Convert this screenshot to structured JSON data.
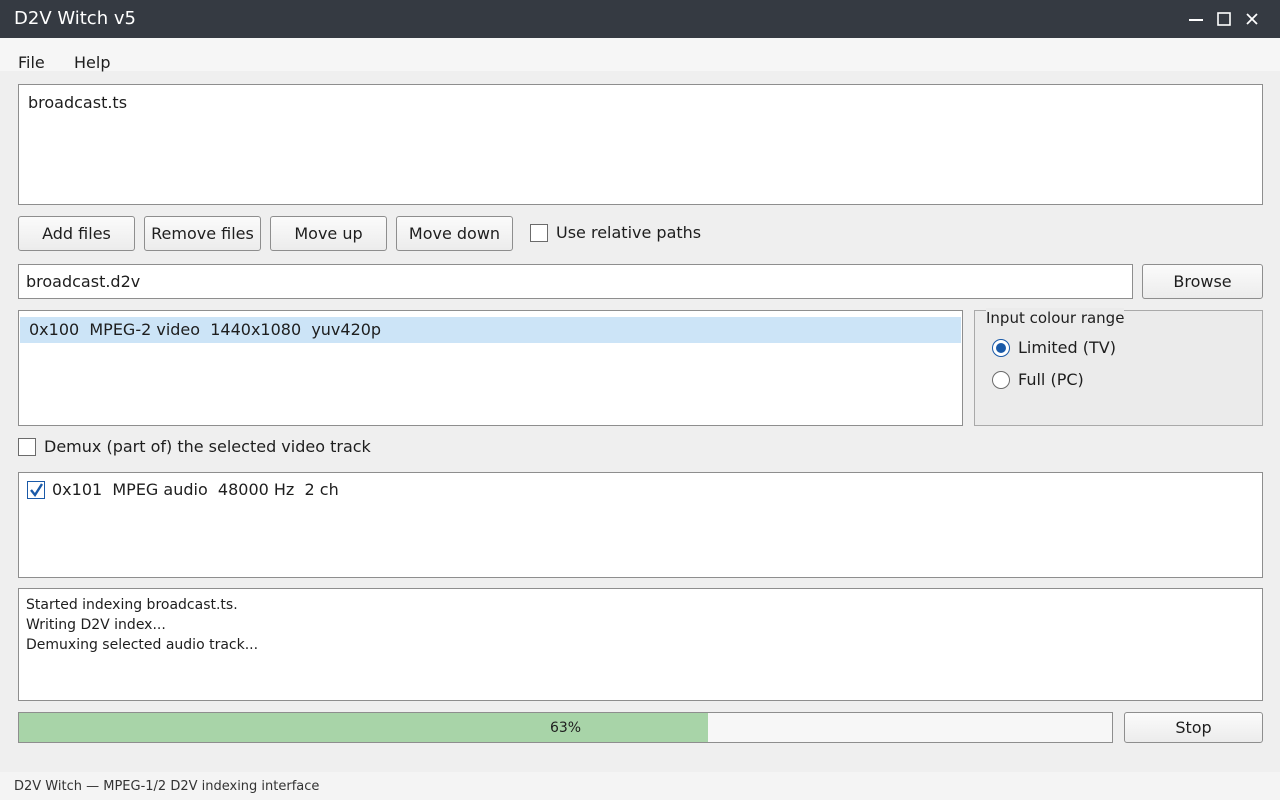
{
  "window": {
    "title": "D2V Witch v5",
    "controls": {
      "minimize_icon": "minimize-icon",
      "maximize_icon": "maximize-icon",
      "close_icon": "close-icon"
    }
  },
  "menu": {
    "items": [
      "File",
      "Help"
    ]
  },
  "files": {
    "list": [
      "broadcast.ts"
    ]
  },
  "file_buttons": {
    "add": "Add files",
    "remove": "Remove files",
    "move_up": "Move up",
    "move_down": "Move down"
  },
  "relative_paths": {
    "label": "Use relative paths",
    "checked": false
  },
  "output": {
    "value": "broadcast.d2v",
    "browse": "Browse"
  },
  "video_tracks": {
    "items": [
      {
        "text": "0x100  MPEG-2 video  1440x1080  yuv420p",
        "selected": true
      }
    ]
  },
  "colour_range": {
    "title": "Input colour range",
    "options": [
      {
        "label": "Limited (TV)",
        "checked": true
      },
      {
        "label": "Full (PC)",
        "checked": false
      }
    ]
  },
  "demux_video": {
    "label": "Demux (part of) the selected video track",
    "checked": false
  },
  "audio_tracks": {
    "items": [
      {
        "text": "0x101  MPEG audio  48000 Hz  2 ch",
        "checked": true
      }
    ]
  },
  "log": {
    "lines": [
      "Started indexing broadcast.ts.",
      "Writing D2V index...",
      "Demuxing selected audio track..."
    ]
  },
  "progress": {
    "percent": 63,
    "label": "63%",
    "color": "#a8d4a8"
  },
  "stop_button": "Stop",
  "status": {
    "text": "D2V Witch — MPEG-1/2 D2V indexing interface"
  },
  "colors": {
    "accent": "#1a5aa8",
    "selection": "#cce4f7",
    "titlebar": "#353a42"
  }
}
